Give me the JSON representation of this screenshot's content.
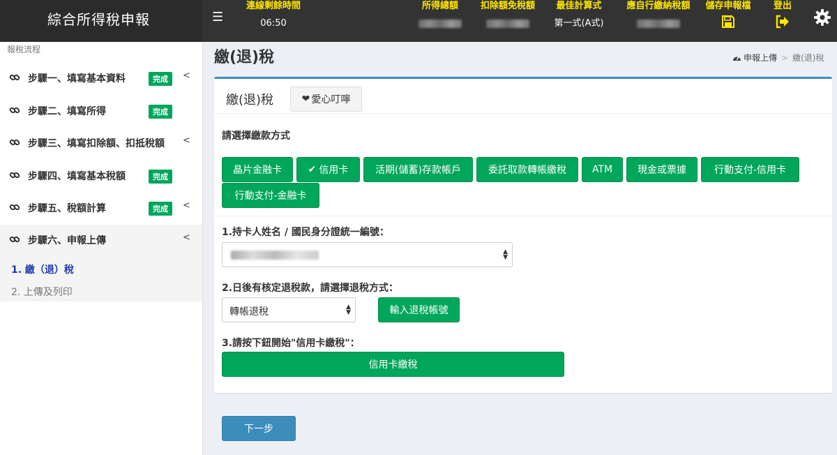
{
  "app": {
    "title": "綜合所得稅申報"
  },
  "header": {
    "time_label": "連線剩餘時間",
    "time_value": "06:50",
    "income_label": "所得總額",
    "deduction_label": "扣除額免稅額",
    "best_label": "最佳計算式",
    "best_value": "第一式(A式)",
    "tax_label": "應自行繳納稅額",
    "save_label": "儲存申報檔",
    "logout_label": "登出"
  },
  "sidebar": {
    "title": "報稅流程",
    "steps": [
      {
        "label": "步驟一、填寫基本資料",
        "badge": "完成"
      },
      {
        "label": "步驟二、填寫所得",
        "badge": "完成"
      },
      {
        "label": "步驟三、填寫扣除額、扣抵稅額",
        "badge": ""
      },
      {
        "label": "步驟四、填寫基本稅額",
        "badge": "完成"
      },
      {
        "label": "步驟五、稅額計算",
        "badge": "完成"
      },
      {
        "label": "步驟六、申報上傳",
        "badge": ""
      }
    ],
    "subitems": [
      {
        "label": "1. 繳（退）稅"
      },
      {
        "label": "2. 上傳及列印"
      }
    ]
  },
  "page": {
    "title": "繳(退)稅",
    "breadcrumb_home": "申報上傳",
    "breadcrumb_sep": ">",
    "breadcrumb_current": "繳(退)稅"
  },
  "box": {
    "title": "繳(退)稅",
    "care_label": "愛心叮嚀",
    "pay_prompt": "請選擇繳款方式",
    "methods": [
      {
        "label": "晶片金融卡"
      },
      {
        "label": "信用卡"
      },
      {
        "label": "活期(儲蓄)存款帳戶"
      },
      {
        "label": "委託取款轉帳繳稅"
      },
      {
        "label": "ATM"
      },
      {
        "label": "現金或票據"
      },
      {
        "label": "行動支付-信用卡"
      },
      {
        "label": "行動支付-金融卡"
      }
    ],
    "q1": "1.持卡人姓名 / 國民身分證統一編號：",
    "q2": "2.日後有核定退稅款，請選擇退稅方式：",
    "refund_value": "轉帳退稅",
    "refund_account_btn": "輸入退稅帳號",
    "q3": "3.請按下鈕開始\"信用卡繳稅\"：",
    "pay_btn": "信用卡繳稅"
  },
  "next_btn": "下一步",
  "colors": {
    "accent": "#00a65a",
    "primary": "#3c8dbc",
    "header_highlight": "#ffe600"
  }
}
